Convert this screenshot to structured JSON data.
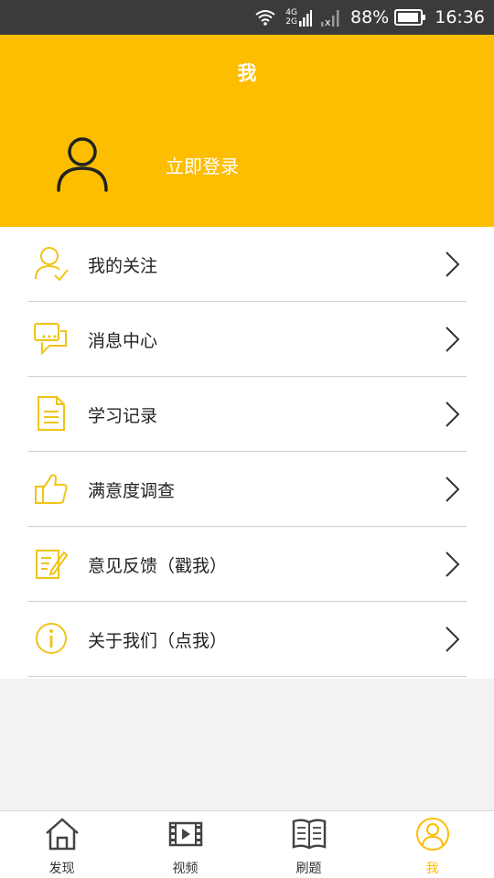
{
  "status_bar": {
    "network_top": "4G",
    "network_bottom": "2G",
    "battery": "88%",
    "time": "16:36",
    "icons": [
      "wifi-icon",
      "signal-icon",
      "signal-x-icon",
      "battery-icon"
    ]
  },
  "header": {
    "title": "我",
    "login_label": "立即登录",
    "avatar_icon": "user-icon"
  },
  "menu": {
    "items": [
      {
        "label": "我的关注",
        "icon": "user-check-icon"
      },
      {
        "label": "消息中心",
        "icon": "chat-bubbles-icon"
      },
      {
        "label": "学习记录",
        "icon": "document-icon"
      },
      {
        "label": "满意度调查",
        "icon": "thumbs-up-icon"
      },
      {
        "label": "意见反馈（戳我）",
        "icon": "edit-note-icon"
      },
      {
        "label": "关于我们（点我）",
        "icon": "info-icon"
      }
    ]
  },
  "tabbar": {
    "tabs": [
      {
        "label": "发现",
        "icon": "home-icon",
        "active": false
      },
      {
        "label": "视频",
        "icon": "film-icon",
        "active": false
      },
      {
        "label": "刷题",
        "icon": "book-icon",
        "active": false
      },
      {
        "label": "我",
        "icon": "profile-icon",
        "active": true
      }
    ]
  },
  "colors": {
    "accent": "#fdbd00",
    "status_bar_bg": "#3b3b3b",
    "divider": "#cfcfcf",
    "page_bg": "#f2f2f2"
  }
}
